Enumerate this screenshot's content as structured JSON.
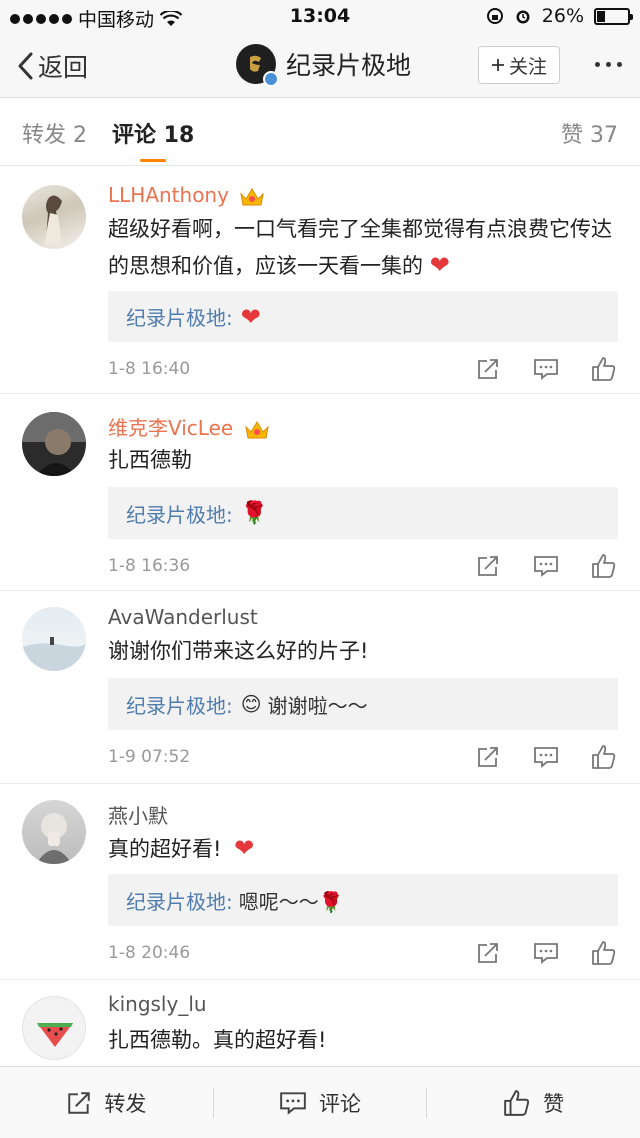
{
  "status_bar": {
    "carrier": "中国移动",
    "time": "13:04",
    "battery": "26%",
    "battery_level": 0.26
  },
  "nav": {
    "back_label": "返回",
    "title": "纪录片极地",
    "follow_label": "关注"
  },
  "tabs": [
    {
      "label": "转发 2"
    },
    {
      "label": "评论 18"
    },
    {
      "label": "赞 37"
    }
  ],
  "comments": [
    {
      "name": "LLHAnthony",
      "vip": true,
      "text": "超级好看啊，一口气看完了全集都觉得有点浪费它传达的思想和价值，应该一天看一集的",
      "text_emoji": "❤",
      "reply_name": "纪录片极地:",
      "reply_emoji": "❤",
      "reply_text": "",
      "time": "1-8 16:40"
    },
    {
      "name": "维克李VicLee",
      "vip": true,
      "text": "扎西德勒",
      "text_emoji": "",
      "reply_name": "纪录片极地:",
      "reply_emoji": "🌹",
      "reply_text": "",
      "time": "1-8 16:36"
    },
    {
      "name": "AvaWanderlust",
      "vip": false,
      "text": "谢谢你们带来这么好的片子!",
      "text_emoji": "",
      "reply_name": "纪录片极地:",
      "reply_emoji": "😊",
      "reply_text": "谢谢啦～～",
      "time": "1-9 07:52"
    },
    {
      "name": "燕小默",
      "vip": false,
      "text": "真的超好看!",
      "text_emoji": "❤",
      "reply_name": "纪录片极地:",
      "reply_emoji": "",
      "reply_text": "嗯呢～～🌹",
      "time": "1-8 20:46"
    },
    {
      "name": "kingsly_lu",
      "vip": false,
      "text": "扎西德勒。真的超好看!",
      "text_emoji": "",
      "reply_name": "",
      "reply_emoji": "",
      "reply_text": "",
      "time": ""
    }
  ],
  "bottom_bar": {
    "repost_label": "转发",
    "comment_label": "评论",
    "like_label": "赞"
  },
  "colors": {
    "accent": "#ff8200",
    "vip_name": "#eb7350",
    "reply_name": "#507daf",
    "heart": "#e5383b"
  },
  "icons": [
    "back-chevron-icon",
    "verified-icon",
    "plus-icon",
    "more-icon",
    "crown-icon",
    "share-icon",
    "comment-icon",
    "like-icon"
  ]
}
